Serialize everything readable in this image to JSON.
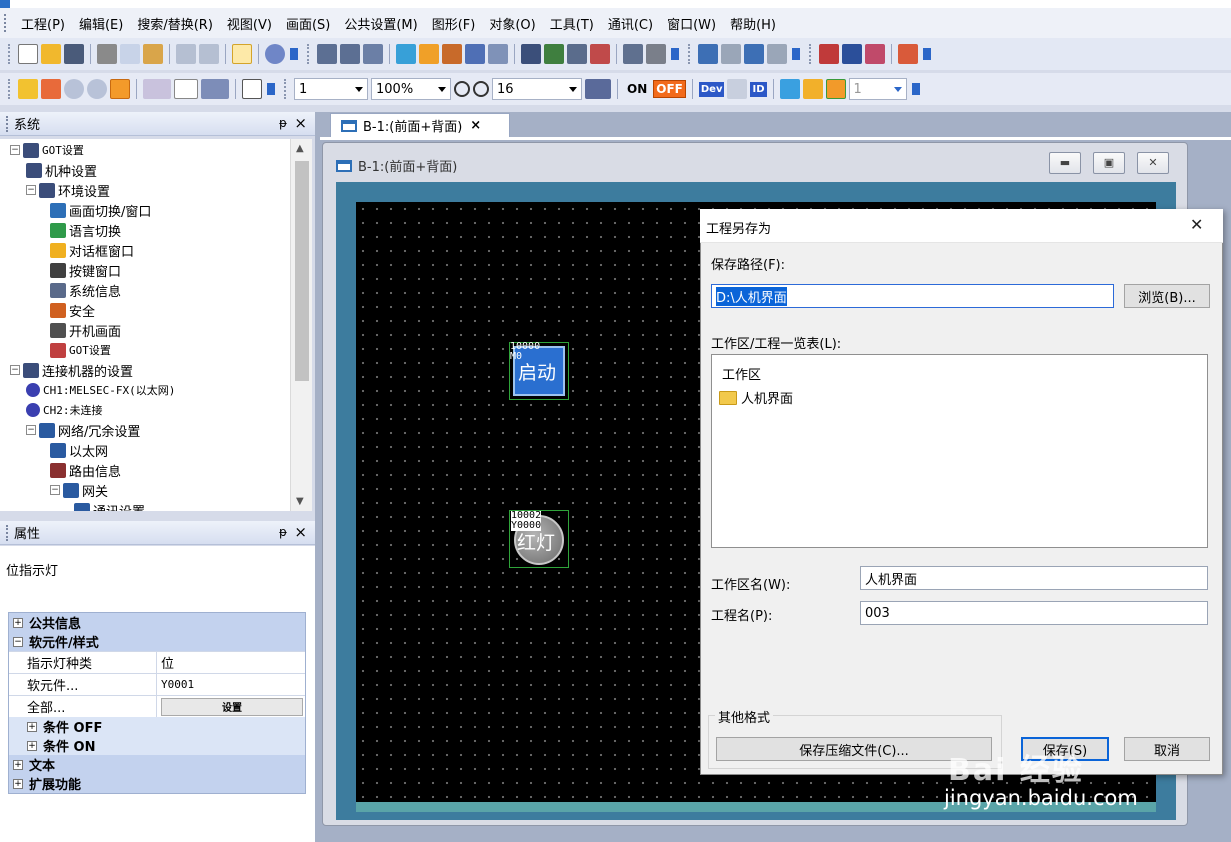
{
  "menubar": {
    "items": [
      "工程(P)",
      "编辑(E)",
      "搜索/替换(R)",
      "视图(V)",
      "画面(S)",
      "公共设置(M)",
      "图形(F)",
      "对象(O)",
      "工具(T)",
      "通讯(C)",
      "窗口(W)",
      "帮助(H)"
    ]
  },
  "toolbar": {
    "line_width": "1",
    "zoom": "100%",
    "grid": "16",
    "on_label": "ON",
    "off_label": "OFF",
    "dev_label": "Dev",
    "id_label": "ID",
    "layer": "1"
  },
  "system_panel": {
    "title": "系统",
    "pin": "ᵽ",
    "close": "×",
    "tree": [
      {
        "label": "GOT设置",
        "level": 0,
        "expander": "−",
        "icon": "got-settings"
      },
      {
        "label": "机种设置",
        "level": 1,
        "icon": "model"
      },
      {
        "label": "环境设置",
        "level": 1,
        "expander": "−",
        "icon": "environment"
      },
      {
        "label": "画面切换/窗口",
        "level": 2,
        "icon": "screen-switch"
      },
      {
        "label": "语言切换",
        "level": 2,
        "icon": "language"
      },
      {
        "label": "对话框窗口",
        "level": 2,
        "icon": "dialog-warning"
      },
      {
        "label": "按键窗口",
        "level": 2,
        "icon": "keypad"
      },
      {
        "label": "系统信息",
        "level": 2,
        "icon": "system-info"
      },
      {
        "label": "安全",
        "level": 2,
        "icon": "security"
      },
      {
        "label": "开机画面",
        "level": 2,
        "icon": "boot-screen"
      },
      {
        "label": "GOT设置",
        "level": 2,
        "icon": "got-settings-sub"
      },
      {
        "label": "连接机器的设置",
        "level": 0,
        "expander": "−",
        "icon": "connection"
      },
      {
        "label": "CH1:MELSEC-FX(以太网)",
        "level": 1,
        "icon": "ch1",
        "badge": "CH1"
      },
      {
        "label": "CH2:未连接",
        "level": 1,
        "icon": "ch2",
        "badge": "CH2"
      },
      {
        "label": "网络/冗余设置",
        "level": 1,
        "expander": "−",
        "icon": "network"
      },
      {
        "label": "以太网",
        "level": 2,
        "icon": "ethernet"
      },
      {
        "label": "路由信息",
        "level": 2,
        "icon": "routing"
      },
      {
        "label": "网关",
        "level": 2,
        "expander": "−",
        "icon": "gateway"
      },
      {
        "label": "通讯设置",
        "level": 3,
        "icon": "comm"
      }
    ]
  },
  "props_panel": {
    "title": "属性",
    "pin": "ᵽ",
    "close": "×",
    "object_kind": "位指示灯",
    "cats": {
      "common": "公共信息",
      "device_style": "软元件/样式",
      "cond_off": "条件 OFF",
      "cond_on": "条件 ON",
      "text": "文本",
      "extended": "扩展功能"
    },
    "rows": [
      {
        "key": "指示灯种类",
        "value": "位"
      },
      {
        "key": "软元件...",
        "value": "Y0001"
      },
      {
        "key": "全部...",
        "value": "设置"
      }
    ]
  },
  "document": {
    "tab_label": "B-1:(前面+背面)",
    "window_title": "B-1:(前面+背面)",
    "switch_object": {
      "id": "10000",
      "device": "M0",
      "text": "启动"
    },
    "lamp_object": {
      "id": "10002",
      "device": "Y0000",
      "text": "红灯"
    }
  },
  "save_dialog": {
    "title": "工程另存为",
    "close": "✕",
    "path_label": "保存路径(F):",
    "path_value": "D:\\人机界面",
    "browse": "浏览(B)...",
    "list_label": "工作区/工程一览表(L):",
    "list_items": [
      "工作区",
      "人机界面"
    ],
    "workspace_label": "工作区名(W):",
    "workspace_value": "人机界面",
    "project_label": "工程名(P):",
    "project_value": "003",
    "other_formats": "其他格式",
    "save_zip": "保存压缩文件(C)...",
    "save": "保存(S)",
    "cancel": "取消"
  },
  "watermark": {
    "logo": "Bai 经验",
    "url": "jingyan.baidu.com"
  },
  "colors": {
    "screen_bg": "#000000",
    "frame": "#3d7c9e",
    "accent": "#0a64d8",
    "switch_blue": "#2a6fd0",
    "lamp_gray": "#8a8a8a"
  }
}
